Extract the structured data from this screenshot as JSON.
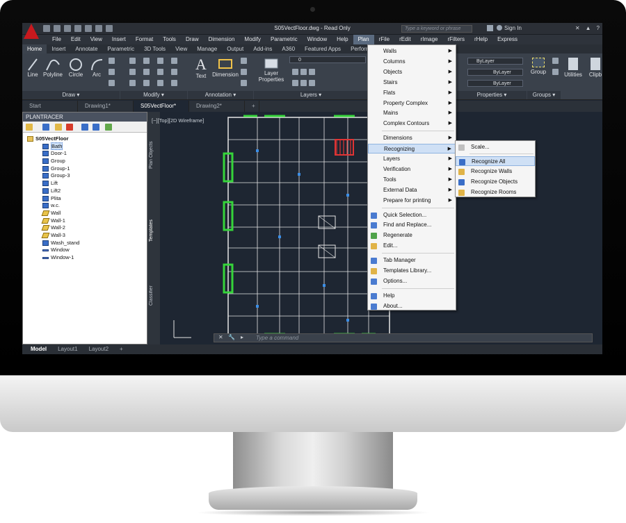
{
  "window": {
    "title": "S05VectFloor.dwg - Read Only",
    "search_placeholder": "Type a keyword or phrase",
    "sign_in": "Sign In",
    "help": "?"
  },
  "menubar": [
    "File",
    "Edit",
    "View",
    "Insert",
    "Format",
    "Tools",
    "Draw",
    "Dimension",
    "Modify",
    "Parametric",
    "Window",
    "Help",
    "Plan",
    "rFile",
    "rEdit",
    "rImage",
    "rFilters",
    "rHelp",
    "Express"
  ],
  "menubar_active": "Plan",
  "ribbon_tabs": [
    "Home",
    "Insert",
    "Annotate",
    "Parametric",
    "3D Tools",
    "View",
    "Manage",
    "Output",
    "Add-ins",
    "A360",
    "Featured Apps",
    "Perform"
  ],
  "ribbon": {
    "draw_tools": [
      "Line",
      "Polyline",
      "Circle",
      "Arc"
    ],
    "draw_label": "Draw",
    "modify_label": "Modify",
    "annotation_tools": [
      "Text",
      "Dimension"
    ],
    "annotation_label": "Annotation",
    "layer_properties": "Layer Properties",
    "layers_label": "Layers",
    "layer_value": "0",
    "properties_label": "Properties",
    "bylayer": [
      "ByLayer",
      "ByLayer",
      "ByLayer"
    ],
    "group": "Group",
    "groups_label": "Groups",
    "utilities": "Utilities",
    "clipboard": "Clipb"
  },
  "doc_tabs": [
    "Start",
    "Drawing1*",
    "S05VectFloor*",
    "Drawing2*"
  ],
  "doc_tab_active": "S05VectFloor*",
  "palette": {
    "title": "PLANTRACER",
    "side_tabs": [
      "Plan Objects",
      "Templates",
      "Classifier"
    ],
    "root": "S05VectFloor",
    "items": [
      {
        "label": "Bath",
        "icon": "grid-icon",
        "selected": true
      },
      {
        "label": "Door-1",
        "icon": "door-icon"
      },
      {
        "label": "Group",
        "icon": "dotted-box-icon"
      },
      {
        "label": "Group-1",
        "icon": "grid-icon"
      },
      {
        "label": "Group-3",
        "icon": "grid-icon"
      },
      {
        "label": "Lift",
        "icon": "grid-icon"
      },
      {
        "label": "Lift2",
        "icon": "grid-icon"
      },
      {
        "label": "Plita",
        "icon": "grid-icon"
      },
      {
        "label": "w.c.",
        "icon": "dotted-box-icon"
      },
      {
        "label": "Wall",
        "icon": "wall-icon"
      },
      {
        "label": "Wall-1",
        "icon": "wall-icon"
      },
      {
        "label": "Wall-2",
        "icon": "wall-icon"
      },
      {
        "label": "Wall-3",
        "icon": "wall-icon"
      },
      {
        "label": "Wash_stand",
        "icon": "grid-icon"
      },
      {
        "label": "Window",
        "icon": "window-icon"
      },
      {
        "label": "Window-1",
        "icon": "window-icon"
      }
    ]
  },
  "viewport_label": "[−][Top][2D Wireframe]",
  "command_placeholder": "Type a command",
  "layout_tabs": [
    "Model",
    "Layout1",
    "Layout2",
    "+"
  ],
  "plan_menu": {
    "items": [
      {
        "label": "Walls",
        "submenu": true
      },
      {
        "label": "Columns",
        "submenu": true
      },
      {
        "label": "Objects",
        "submenu": true
      },
      {
        "label": "Stairs",
        "submenu": true
      },
      {
        "label": "Flats",
        "submenu": true
      },
      {
        "label": "Property Complex",
        "submenu": true
      },
      {
        "label": "Mains",
        "submenu": true
      },
      {
        "label": "Complex Contours",
        "submenu": true
      },
      {
        "label": "Dimensions",
        "submenu": true
      },
      {
        "label": "Recognizing",
        "submenu": true,
        "highlighted": true
      },
      {
        "label": "Layers",
        "submenu": true
      },
      {
        "label": "Verification",
        "submenu": true
      },
      {
        "label": "Tools",
        "submenu": true
      },
      {
        "label": "External Data",
        "submenu": true
      },
      {
        "label": "Prepare for printing",
        "submenu": true
      },
      {
        "label": "Quick Selection..."
      },
      {
        "label": "Find and Replace..."
      },
      {
        "label": "Regenerate"
      },
      {
        "label": "Edit..."
      },
      {
        "label": "Tab Manager"
      },
      {
        "label": "Templates Library..."
      },
      {
        "label": "Options..."
      },
      {
        "label": "Help"
      },
      {
        "label": "About..."
      }
    ]
  },
  "recognizing_submenu": {
    "items": [
      {
        "label": "Scale..."
      },
      {
        "label": "Recognize All",
        "highlighted": true
      },
      {
        "label": "Recognize Walls"
      },
      {
        "label": "Recognize Objects"
      },
      {
        "label": "Recognize Rooms"
      }
    ]
  },
  "colors": {
    "accent": "#c8191e",
    "menu_highlight": "#cfe0f5",
    "wall_green": "#35d43a",
    "plan_lines": "#e6e6e6"
  }
}
